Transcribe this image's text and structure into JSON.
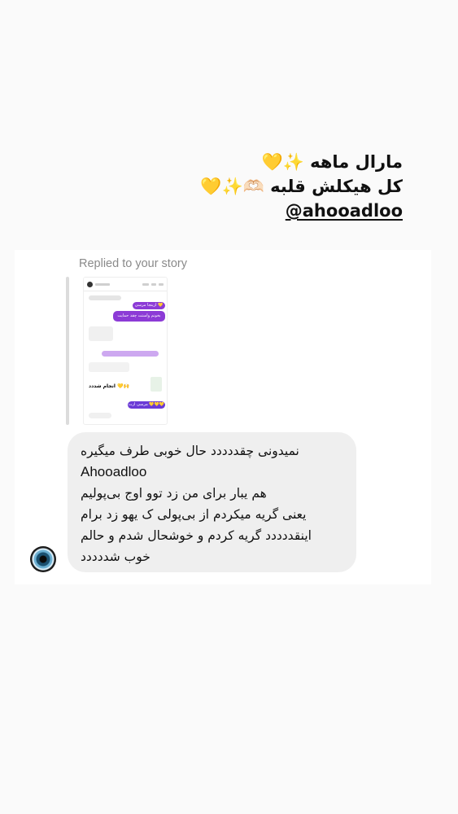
{
  "caption": {
    "line1": "مارال ماهه ✨💛",
    "line2": "کل هیکلش قلبه 🫶🏻✨💛",
    "mention": "@ahooadloo"
  },
  "dm": {
    "replied_label": "Replied to your story",
    "story_preview": {
      "texts": [
        "ازینجا مرسی 💛💛💛",
        "بخونم واستت چقد حمایت میکنی 💛",
        "انجام شددد 💛🙌",
        "مرسی ازت 💛💛💛"
      ]
    },
    "message_lines": [
      "نمیدونی چقددددد حال خوبی طرف میگیره",
      "Ahooadloo",
      "هم یبار برای من زد توو اوج بی‌پولیم",
      "یعنی گریه میکردم از بی‌پولی ک یهو زد برام",
      "اینقددددد گریه کردم و خوشحال شدم و حالم",
      "خوب شددددد"
    ]
  },
  "colors": {
    "background": "#fafafa",
    "card": "#ffffff",
    "bubble": "#efefef",
    "story_purple": "#8c3bd6"
  }
}
